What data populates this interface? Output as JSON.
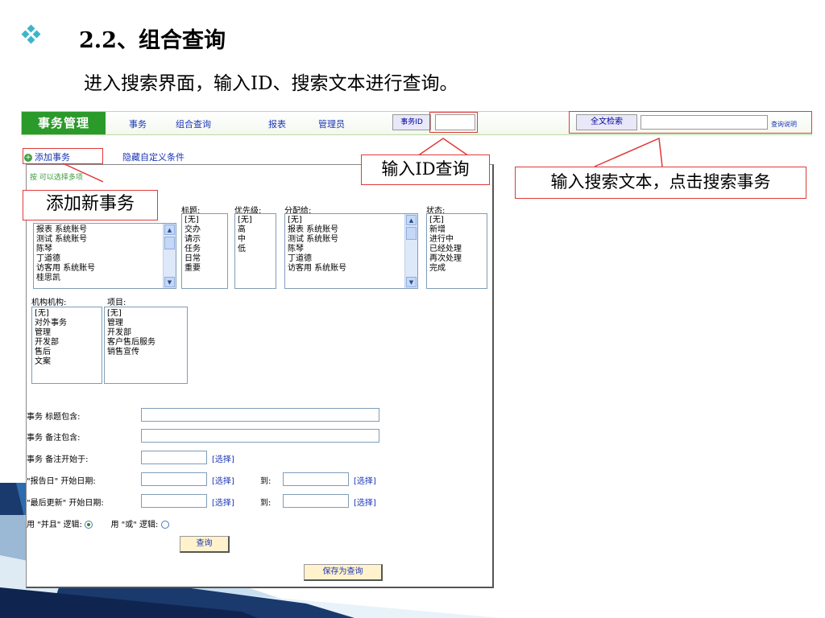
{
  "slide": {
    "heading": "2.2、组合查询",
    "subline": "进入搜索界面，输入ID、搜索文本进行查询。"
  },
  "topbar": {
    "brand": "事务管理",
    "nav": [
      "事务",
      "组合查询",
      "报表",
      "管理员"
    ],
    "id_label": "事务ID",
    "fulltext_button": "全文检索",
    "help_link": "查询说明"
  },
  "actions": {
    "add_issue": "添加事务",
    "hide_custom": "隐藏自定义条件"
  },
  "panel": {
    "hint": "按    可以选择多项",
    "users_list": [
      "报表 系统账号",
      "测试 系统账号",
      "陈琴",
      "丁道德",
      "访客用 系统账号",
      "桂思凯"
    ],
    "title_label": "标题:",
    "title_list": [
      "[无]",
      "交办",
      "请示",
      "任务",
      "日常",
      "重要"
    ],
    "priority_label": "优先级:",
    "priority_list": [
      "[无]",
      "高",
      "中",
      "低"
    ],
    "assign_label": "分配给:",
    "assign_list": [
      "[无]",
      "报表 系统账号",
      "测试 系统账号",
      "陈琴",
      "丁道德",
      "访客用 系统账号"
    ],
    "status_label": "状态:",
    "status_list": [
      "[无]",
      "新增",
      "进行中",
      "已经处理",
      "再次处理",
      "完成"
    ],
    "org_label": "机构机构:",
    "org_list": [
      "[无]",
      "对外事务",
      "管理",
      "开发部",
      "售后",
      "文案"
    ],
    "project_label": "项目:",
    "project_list": [
      "[无]",
      "管理",
      "开发部",
      "客户售后服务",
      "销售宣传"
    ],
    "title_contains": "事务 标题包含:",
    "note_contains": "事务 备注包含:",
    "note_starts": "事务 备注开始于:",
    "report_date": "\"报告日\" 开始日期:",
    "updated_date": "\"最后更新\" 开始日期:",
    "pick": "[选择]",
    "to": "到:",
    "and_logic": "用 \"并且\" 逻辑:",
    "or_logic": "用 \"或\" 逻辑:",
    "query_button": "查询",
    "save_button": "保存为查询"
  },
  "callouts": {
    "add_new": "添加新事务",
    "input_id": "输入ID查询",
    "input_text": "输入搜索文本，点击搜索事务"
  },
  "colors": {
    "brand_green": "#2a9b2a",
    "link_blue": "#1a35b5",
    "callout_red": "#e03a3a",
    "accent_teal": "#3bb6c8"
  }
}
